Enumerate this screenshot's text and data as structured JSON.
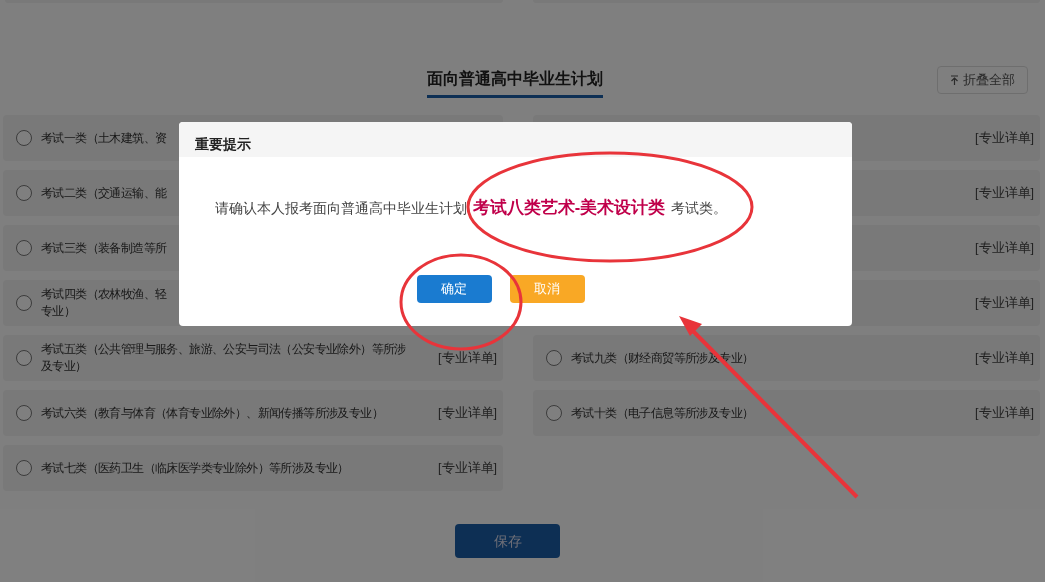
{
  "section_title": "面向普通高中毕业生计划",
  "collapse_button": {
    "label": "折叠全部"
  },
  "left_items": [
    {
      "lines": [
        "考试一类（土木建筑、资"
      ],
      "selected": false
    },
    {
      "lines": [
        "考试二类（交通运输、能"
      ],
      "selected": false
    },
    {
      "lines": [
        "考试三类（装备制造等所"
      ],
      "selected": false
    },
    {
      "lines": [
        "考试四类（农林牧渔、轻",
        "专业）"
      ],
      "selected": false
    },
    {
      "lines": [
        "考试五类（公共管理与服务、旅游、公安与司法（公安专业除外）等所涉及专业）"
      ],
      "selected": false,
      "link": "[专业详单]"
    },
    {
      "lines": [
        "考试六类（教育与体育（体育专业除外）、新闻传播等所涉及专业）"
      ],
      "selected": false,
      "link": "[专业详单]"
    },
    {
      "lines": [
        "考试七类（医药卫生（临床医学类专业除外）等所涉及专业）"
      ],
      "selected": false,
      "link": "[专业详单]"
    }
  ],
  "right_items": [
    {
      "link": "[专业详单]"
    },
    {
      "link": "[专业详单]"
    },
    {
      "link": "[专业详单]"
    },
    {
      "link": "[专业详单]"
    },
    {
      "lines": [
        "考试九类（财经商贸等所涉及专业）"
      ],
      "selected": false,
      "link": "[专业详单]"
    },
    {
      "lines": [
        "考试十类（电子信息等所涉及专业）"
      ],
      "selected": false,
      "link": "[专业详单]"
    }
  ],
  "save_button": {
    "label": "保存"
  },
  "dialog": {
    "title": "重要提示",
    "message": "请确认本人报考面向普通高中毕业生计划 **考试八类艺术-美术设计类** 考试类。",
    "buttons": [
      {
        "label": "确定",
        "kind": "primary"
      },
      {
        "label": "取消",
        "kind": "warning"
      }
    ]
  }
}
